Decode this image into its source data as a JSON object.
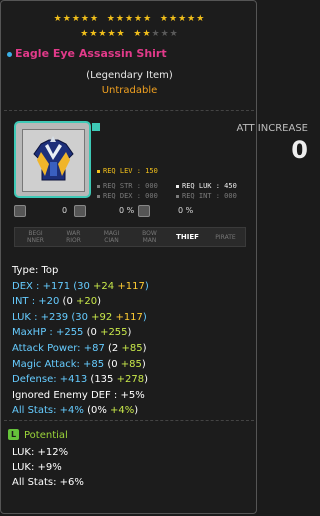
{
  "stars": {
    "row1_filled": 15,
    "row2_filled": 7,
    "row2_total": 10
  },
  "item": {
    "name": "Eagle Eye Assassin Shirt",
    "grade_line": "(Legendary Item)",
    "trade_line": "Untradable"
  },
  "att": {
    "label": "ATT INCREASE",
    "value": "0"
  },
  "req": {
    "lev": "REQ LEV : 150",
    "str": "REQ STR : 000",
    "dex": "REQ DEX : 000",
    "luk": "REQ LUK : 450",
    "int": "REQ INT : 000"
  },
  "small_stats": [
    "0",
    "0 %",
    "0 %"
  ],
  "jobs": [
    {
      "label": "BEGI\nNNER",
      "active": false
    },
    {
      "label": "WAR\nRIOR",
      "active": false
    },
    {
      "label": "MAGI\nCIAN",
      "active": false
    },
    {
      "label": "BOW\nMAN",
      "active": false
    },
    {
      "label": "THIEF",
      "active": true
    },
    {
      "label": "PIRATE",
      "active": false
    }
  ],
  "stats": [
    {
      "text": "Type: Top",
      "color": "white"
    },
    {
      "parts": [
        {
          "t": "DEX : +171 (30 ",
          "c": "#66ccff"
        },
        {
          "t": "+24 ",
          "c": "#c8e84a"
        },
        {
          "t": "+117",
          "c": "#ffcc33"
        },
        {
          "t": ")",
          "c": "#66ccff"
        }
      ]
    },
    {
      "parts": [
        {
          "t": "INT : +20 ",
          "c": "#66ccff"
        },
        {
          "t": "(0 ",
          "c": "#ffffff"
        },
        {
          "t": "+20",
          "c": "#c8e84a"
        },
        {
          "t": ")",
          "c": "#ffffff"
        }
      ]
    },
    {
      "parts": [
        {
          "t": "LUK : +239 (30 ",
          "c": "#66ccff"
        },
        {
          "t": "+92 ",
          "c": "#c8e84a"
        },
        {
          "t": "+117",
          "c": "#ffcc33"
        },
        {
          "t": ")",
          "c": "#66ccff"
        }
      ]
    },
    {
      "parts": [
        {
          "t": "MaxHP : +255 ",
          "c": "#66ccff"
        },
        {
          "t": "(0 ",
          "c": "#ffffff"
        },
        {
          "t": "+255",
          "c": "#c8e84a"
        },
        {
          "t": ")",
          "c": "#ffffff"
        }
      ]
    },
    {
      "parts": [
        {
          "t": "Attack Power: +87 ",
          "c": "#66ccff"
        },
        {
          "t": "(2 ",
          "c": "#ffffff"
        },
        {
          "t": "+85",
          "c": "#c8e84a"
        },
        {
          "t": ")",
          "c": "#ffffff"
        }
      ]
    },
    {
      "parts": [
        {
          "t": "Magic Attack: +85 ",
          "c": "#66ccff"
        },
        {
          "t": "(0 ",
          "c": "#ffffff"
        },
        {
          "t": "+85",
          "c": "#c8e84a"
        },
        {
          "t": ")",
          "c": "#ffffff"
        }
      ]
    },
    {
      "parts": [
        {
          "t": "Defense: +413 ",
          "c": "#66ccff"
        },
        {
          "t": "(135 ",
          "c": "#ffffff"
        },
        {
          "t": "+278",
          "c": "#c8e84a"
        },
        {
          "t": ")",
          "c": "#ffffff"
        }
      ]
    },
    {
      "parts": [
        {
          "t": "Ignored Enemy DEF : +5%",
          "c": "#ffffff"
        }
      ]
    },
    {
      "parts": [
        {
          "t": "All Stats: +4% ",
          "c": "#66ccff"
        },
        {
          "t": "(0% ",
          "c": "#ffffff"
        },
        {
          "t": "+4%",
          "c": "#c8e84a"
        },
        {
          "t": ")",
          "c": "#ffffff"
        }
      ]
    }
  ],
  "potential": {
    "title": "Potential",
    "lines": [
      "LUK: +12%",
      "LUK: +9%",
      "All Stats: +6%"
    ]
  },
  "colors": {
    "star": "#f2c01b",
    "name": "#e23a8a",
    "untradable": "#f0a020",
    "grade_border": "#3ec9b6",
    "potential": "#9bd43a"
  }
}
